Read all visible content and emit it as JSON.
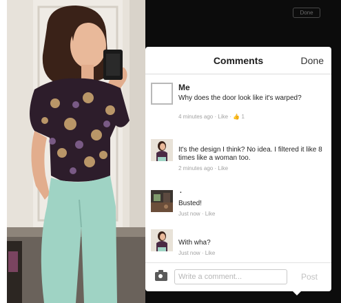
{
  "background": {
    "done_label": "Done"
  },
  "panel": {
    "title": "Comments",
    "done_label": "Done"
  },
  "comments": [
    {
      "author": "Me",
      "text": "Why does the door look like it's warped?",
      "time": "4 minutes ago",
      "like": "Like",
      "like_count": "1",
      "avatar": "empty-avatar"
    },
    {
      "author": "",
      "text": "It's the design I think? No idea. I filtered it like 8 times like a woman too.",
      "time": "2 minutes ago",
      "like": "Like",
      "avatar": "girl-avatar"
    },
    {
      "author": ".",
      "text": "Busted!",
      "time": "Just now",
      "like": "Like",
      "avatar": "room-avatar"
    },
    {
      "author": "",
      "text": "With wha?",
      "time": "Just now",
      "like": "Like",
      "avatar": "girl-avatar"
    }
  ],
  "composer": {
    "placeholder": "Write a comment...",
    "post_label": "Post",
    "camera_icon": "camera-icon"
  },
  "colors": {
    "dark_background": "#0c0c0c",
    "link_blue": "#6a82b8",
    "meta_gray": "#a2a2a2"
  }
}
